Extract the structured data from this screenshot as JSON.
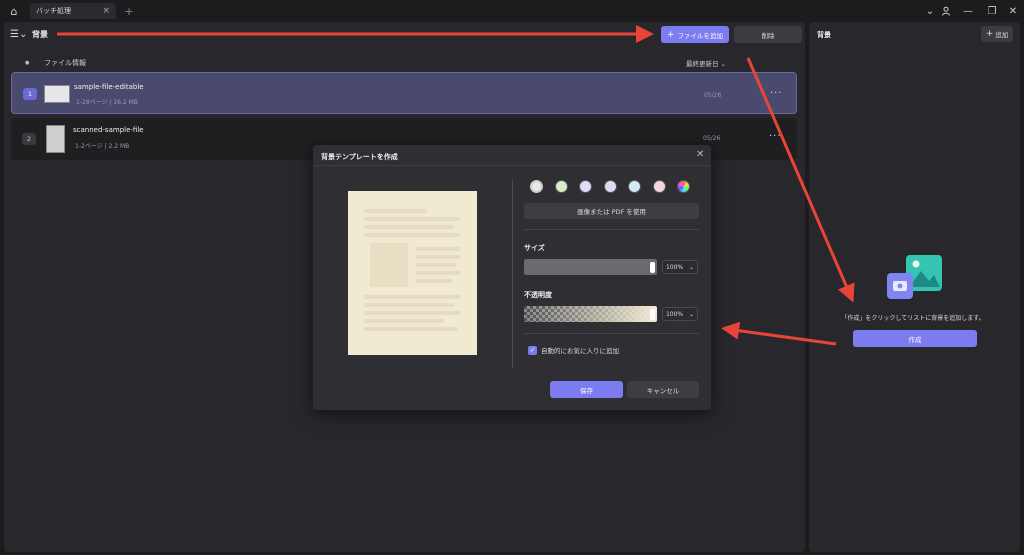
{
  "titlebar": {
    "tab_label": "バッチ処理",
    "tab_close": "×",
    "tab_add": "+",
    "window_controls": [
      "⌄",
      "👤",
      "—",
      "❐",
      "✕"
    ]
  },
  "left_panel": {
    "title": "背景",
    "menu_icon": "☰⌄",
    "add_file_label": "ファイルを追加",
    "add_icon": "+",
    "delete_label": "削除",
    "header_dot": "●",
    "header_fileinfo": "ファイル情報",
    "header_sort": "最終更新日 ⌄",
    "files": [
      {
        "index": "1",
        "name": "sample-file-editable",
        "meta": "1-28ページ  |  16.2 MB",
        "date": "05/26",
        "more": "···"
      },
      {
        "index": "2",
        "name": "scanned-sample-file",
        "meta": "1-2ページ  |  2.2 MB",
        "date": "05/26",
        "more": "···"
      }
    ]
  },
  "right_panel": {
    "title": "背景",
    "add_label": "追加",
    "add_icon": "+",
    "hint": "「作成」をクリックしてリストに背景を追加します。",
    "create_label": "作成"
  },
  "dialog": {
    "title": "背景テンプレートを作成",
    "close": "✕",
    "swatches": [
      "#e8e8e8",
      "#d7ecc8",
      "#dcdcf4",
      "#dcdcf4",
      "#d0ecf2",
      "#f6d6de",
      "rainbow"
    ],
    "use_image_label": "画像または PDF を使用",
    "size_label": "サイズ",
    "size_value": "100%",
    "opacity_label": "不透明度",
    "opacity_value": "100%",
    "dropdown_arrow": "⌄",
    "auto_favorite_label": "自動的にお気に入りに追加",
    "auto_favorite_checked": true,
    "checkmark": "✓",
    "save_label": "保存",
    "cancel_label": "キャンセル",
    "paper_color": "#f1ead2"
  },
  "colors": {
    "accent": "#7c7cf0",
    "annotation_arrow": "#e8443a"
  }
}
